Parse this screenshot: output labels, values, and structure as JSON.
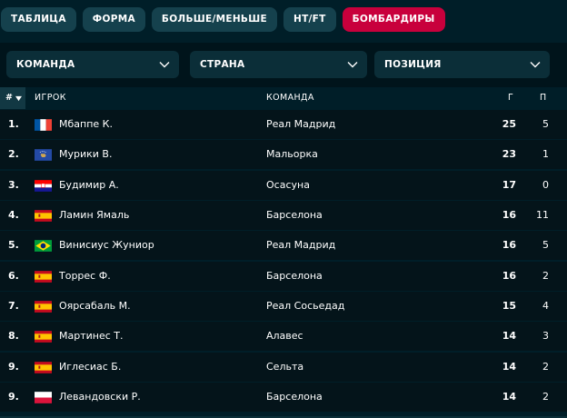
{
  "tabs": [
    {
      "label": "ТАБЛИЦА",
      "active": false
    },
    {
      "label": "ФОРМА",
      "active": false
    },
    {
      "label": "БОЛЬШЕ/МЕНЬШЕ",
      "active": false
    },
    {
      "label": "HT/FT",
      "active": false
    },
    {
      "label": "БОМБАРДИРЫ",
      "active": true
    }
  ],
  "filters": [
    {
      "label": "КОМАНДА",
      "icon": "chevron-down-icon"
    },
    {
      "label": "СТРАНА",
      "icon": "chevron-down-icon"
    },
    {
      "label": "ПОЗИЦИЯ",
      "icon": "chevron-down-icon"
    }
  ],
  "columns": {
    "rank": "#",
    "player": "ИГРОК",
    "team": "КОМАНДА",
    "goals": "Г",
    "assists": "П",
    "sort_icon": "sort-down-icon"
  },
  "rows": [
    {
      "rank": "1.",
      "flag": "france-flag-icon",
      "player": "Мбаппе К.",
      "team": "Реал Мадрид",
      "goals": "25",
      "assists": "5"
    },
    {
      "rank": "2.",
      "flag": "kosovo-flag-icon",
      "player": "Мурики В.",
      "team": "Мальорка",
      "goals": "23",
      "assists": "1"
    },
    {
      "rank": "3.",
      "flag": "croatia-flag-icon",
      "player": "Будимир А.",
      "team": "Осасуна",
      "goals": "17",
      "assists": "0"
    },
    {
      "rank": "4.",
      "flag": "spain-flag-icon",
      "player": "Ламин Ямаль",
      "team": "Барселона",
      "goals": "16",
      "assists": "11"
    },
    {
      "rank": "5.",
      "flag": "brazil-flag-icon",
      "player": "Винисиус Жуниор",
      "team": "Реал Мадрид",
      "goals": "16",
      "assists": "5"
    },
    {
      "rank": "6.",
      "flag": "spain-flag-icon",
      "player": "Торрес Ф.",
      "team": "Барселона",
      "goals": "16",
      "assists": "2"
    },
    {
      "rank": "7.",
      "flag": "spain-flag-icon",
      "player": "Оярсабаль М.",
      "team": "Реал Сосьедад",
      "goals": "15",
      "assists": "4"
    },
    {
      "rank": "8.",
      "flag": "spain-flag-icon",
      "player": "Мартинес Т.",
      "team": "Алавес",
      "goals": "14",
      "assists": "3"
    },
    {
      "rank": "9.",
      "flag": "spain-flag-icon",
      "player": "Иглесиас Б.",
      "team": "Сельта",
      "goals": "14",
      "assists": "2"
    },
    {
      "rank": "9.",
      "flag": "poland-flag-icon",
      "player": "Левандовски Р.",
      "team": "Барселона",
      "goals": "14",
      "assists": "2"
    }
  ],
  "colors": {
    "background": "#001e28",
    "row": "#04141a",
    "tab": "#15414d",
    "active_tab": "#c8003c",
    "filter": "#0b2e38"
  }
}
